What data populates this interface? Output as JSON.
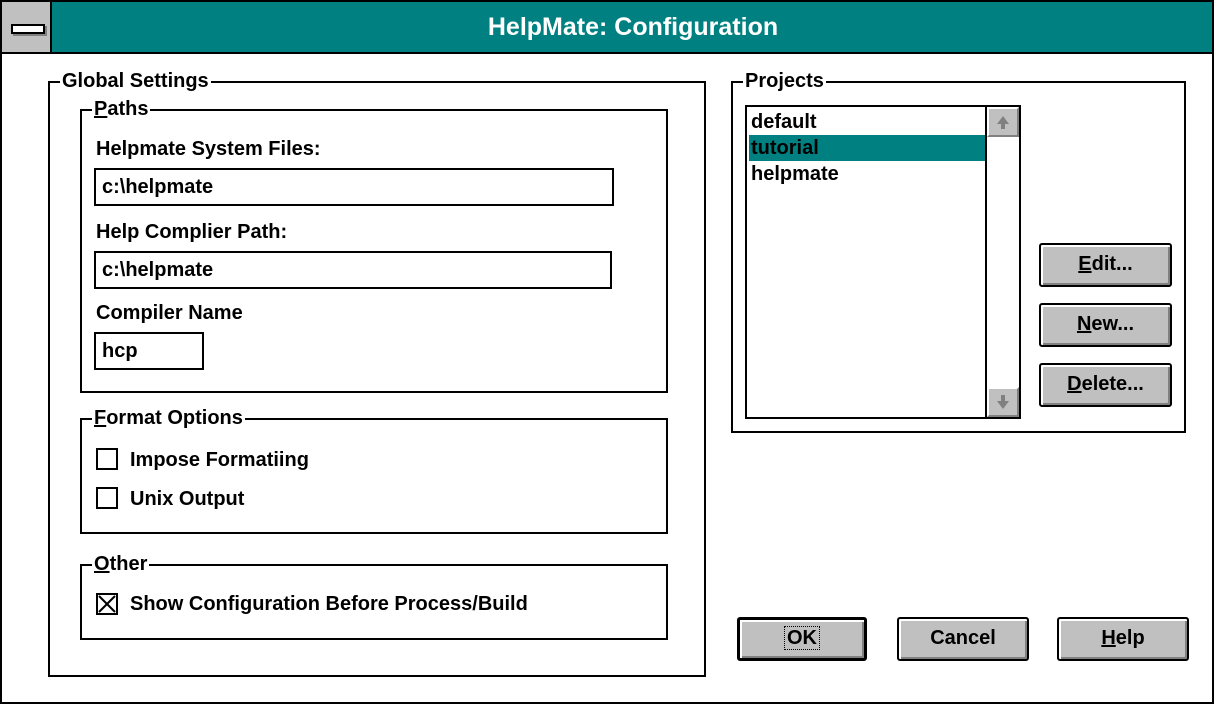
{
  "window": {
    "title": "HelpMate: Configuration"
  },
  "global_settings": {
    "label": "Global Settings",
    "paths": {
      "label": "Paths",
      "system_files_label": "Helpmate System Files:",
      "system_files_value": "c:\\helpmate",
      "compiler_path_label": "Help Complier Path:",
      "compiler_path_value": "c:\\helpmate",
      "compiler_name_label": "Compiler Name",
      "compiler_name_value": "hcp"
    },
    "format_options": {
      "label": "Format Options",
      "impose_formatting_label": "Impose Formatiing",
      "impose_formatting_checked": false,
      "unix_output_label": "Unix Output",
      "unix_output_checked": false
    },
    "other": {
      "label": "Other",
      "show_config_label": "Show Configuration Before Process/Build",
      "show_config_checked": true
    }
  },
  "projects": {
    "label": "Projects",
    "items": [
      "default",
      "tutorial",
      "helpmate"
    ],
    "selected": "tutorial",
    "edit_label": "Edit...",
    "new_label": "New...",
    "delete_label": "Delete..."
  },
  "buttons": {
    "ok": "OK",
    "cancel": "Cancel",
    "help": "Help"
  },
  "colors": {
    "title_bar": "#008080",
    "selection": "#008080",
    "button_face": "#c0c0c0"
  }
}
